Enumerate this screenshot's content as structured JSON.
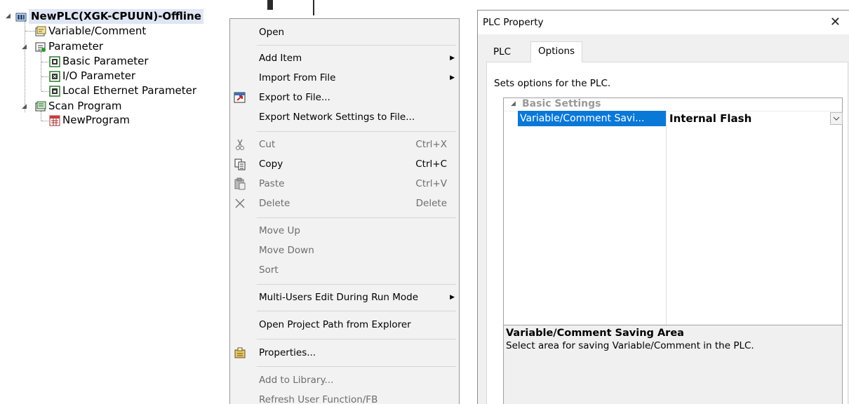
{
  "tree": {
    "root": "NewPLC(XGK-CPUUN)-Offline",
    "items": [
      "Variable/Comment",
      "Parameter",
      "Basic Parameter",
      "I/O Parameter",
      "Local Ethernet Parameter",
      "Scan Program",
      "NewProgram"
    ]
  },
  "context_menu": {
    "items": [
      {
        "label": "Open"
      },
      {
        "label": "Add Item",
        "submenu": true
      },
      {
        "label": "Import From File",
        "submenu": true
      },
      {
        "label": "Export to File...",
        "icon": "export-icon"
      },
      {
        "label": "Export Network Settings to File..."
      },
      {
        "label": "Cut",
        "shortcut": "Ctrl+X",
        "icon": "scissors-icon",
        "disabled": true
      },
      {
        "label": "Copy",
        "shortcut": "Ctrl+C",
        "icon": "copy-icon"
      },
      {
        "label": "Paste",
        "shortcut": "Ctrl+V",
        "icon": "paste-icon",
        "disabled": true
      },
      {
        "label": "Delete",
        "shortcut": "Delete",
        "icon": "delete-x-icon",
        "disabled": true
      },
      {
        "label": "Move Up",
        "disabled": true
      },
      {
        "label": "Move Down",
        "disabled": true
      },
      {
        "label": "Sort",
        "disabled": true
      },
      {
        "label": "Multi-Users Edit During Run Mode",
        "submenu": true
      },
      {
        "label": "Open Project Path from Explorer"
      },
      {
        "label": "Properties...",
        "icon": "properties-icon"
      },
      {
        "label": "Add to Library...",
        "disabled": true
      },
      {
        "label": "Refresh User Function/FB",
        "disabled": true
      }
    ]
  },
  "dialog": {
    "title": "PLC Property",
    "close_glyph": "✕",
    "tabs": [
      "PLC",
      "Options"
    ],
    "active_tab": "Options",
    "description": "Sets options for the PLC.",
    "category": "Basic Settings",
    "property_name": "Variable/Comment Savi...",
    "property_value": "Internal Flash",
    "help_title": "Variable/Comment Saving Area",
    "help_text": "Select area for saving Variable/Comment in the PLC."
  },
  "colors": {
    "selection": "#0a78d7",
    "menu_bg": "#f2f2f2",
    "disabled_text": "#6d6d6d"
  }
}
